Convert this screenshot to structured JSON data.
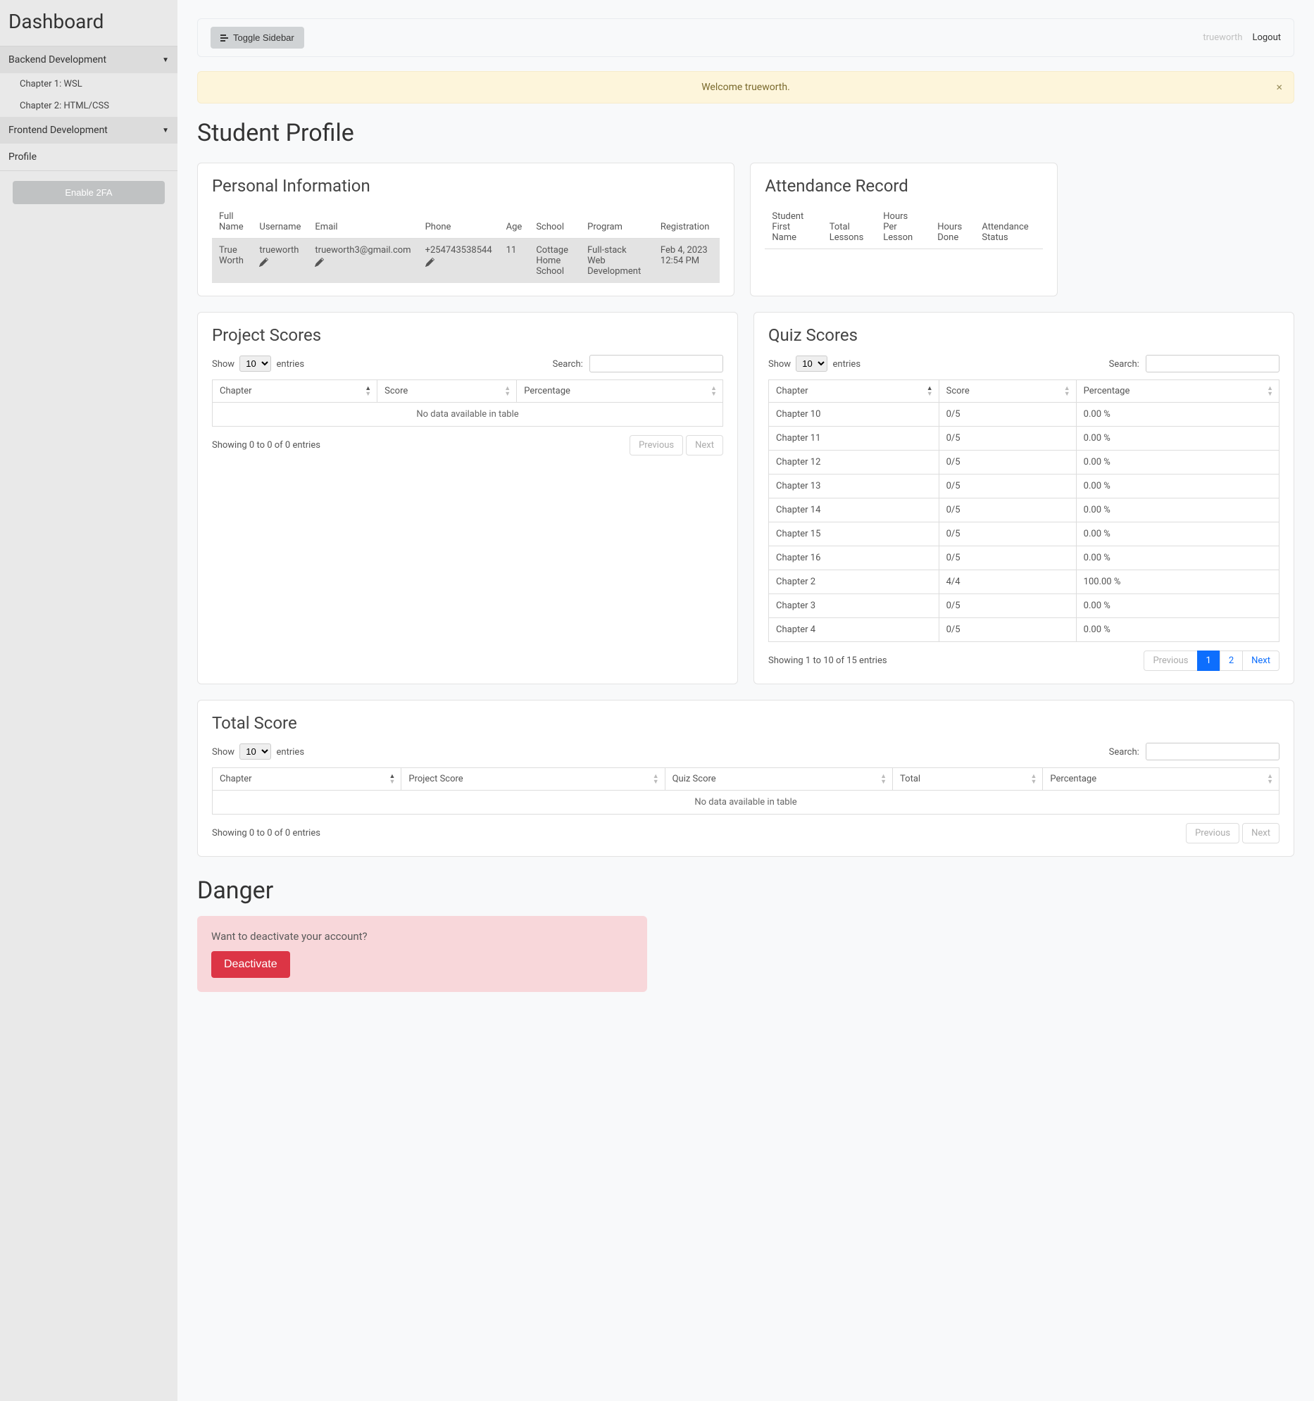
{
  "sidebar": {
    "title": "Dashboard",
    "categories": [
      {
        "label": "Backend Development",
        "subs": [
          "Chapter 1: WSL",
          "Chapter 2: HTML/CSS"
        ]
      },
      {
        "label": "Frontend Development",
        "subs": []
      }
    ],
    "profile_label": "Profile",
    "enable_2fa": "Enable 2FA"
  },
  "topbar": {
    "toggle": "Toggle Sidebar",
    "user": "trueworth",
    "logout": "Logout"
  },
  "alert": {
    "text": "Welcome trueworth.",
    "close": "×"
  },
  "page_title": "Student Profile",
  "personal": {
    "title": "Personal Information",
    "headers": {
      "full_name": "Full Name",
      "username": "Username",
      "email": "Email",
      "phone": "Phone",
      "age": "Age",
      "school": "School",
      "program": "Program",
      "registration": "Registration"
    },
    "row": {
      "full_name": "True Worth",
      "username": "trueworth",
      "email": "trueworth3@gmail.com",
      "phone": "+254743538544",
      "age": "11",
      "school": "Cottage Home School",
      "program": "Full-stack Web Development",
      "registration": "Feb 4, 2023 12:54 PM"
    }
  },
  "attendance": {
    "title": "Attendance Record",
    "headers": {
      "first_name": "Student First Name",
      "total_lessons": "Total Lessons",
      "hours_per_lesson": "Hours Per Lesson",
      "hours_done": "Hours Done",
      "status": "Attendance Status"
    }
  },
  "project": {
    "title": "Project Scores",
    "show": "Show",
    "entries": "entries",
    "search": "Search:",
    "headers": {
      "chapter": "Chapter",
      "score": "Score",
      "percentage": "Percentage"
    },
    "no_data": "No data available in table",
    "info": "Showing 0 to 0 of 0 entries",
    "prev": "Previous",
    "next": "Next",
    "page_size": "10"
  },
  "quiz": {
    "title": "Quiz Scores",
    "show": "Show",
    "entries": "entries",
    "search": "Search:",
    "headers": {
      "chapter": "Chapter",
      "score": "Score",
      "percentage": "Percentage"
    },
    "rows": [
      {
        "chapter": "Chapter 10",
        "score": "0/5",
        "percentage": "0.00 %"
      },
      {
        "chapter": "Chapter 11",
        "score": "0/5",
        "percentage": "0.00 %"
      },
      {
        "chapter": "Chapter 12",
        "score": "0/5",
        "percentage": "0.00 %"
      },
      {
        "chapter": "Chapter 13",
        "score": "0/5",
        "percentage": "0.00 %"
      },
      {
        "chapter": "Chapter 14",
        "score": "0/5",
        "percentage": "0.00 %"
      },
      {
        "chapter": "Chapter 15",
        "score": "0/5",
        "percentage": "0.00 %"
      },
      {
        "chapter": "Chapter 16",
        "score": "0/5",
        "percentage": "0.00 %"
      },
      {
        "chapter": "Chapter 2",
        "score": "4/4",
        "percentage": "100.00 %"
      },
      {
        "chapter": "Chapter 3",
        "score": "0/5",
        "percentage": "0.00 %"
      },
      {
        "chapter": "Chapter 4",
        "score": "0/5",
        "percentage": "0.00 %"
      }
    ],
    "info": "Showing 1 to 10 of 15 entries",
    "prev": "Previous",
    "next": "Next",
    "pages": [
      "1",
      "2"
    ],
    "page_size": "10"
  },
  "total": {
    "title": "Total Score",
    "show": "Show",
    "entries": "entries",
    "search": "Search:",
    "headers": {
      "chapter": "Chapter",
      "project_score": "Project Score",
      "quiz_score": "Quiz Score",
      "total": "Total",
      "percentage": "Percentage"
    },
    "no_data": "No data available in table",
    "info": "Showing 0 to 0 of 0 entries",
    "prev": "Previous",
    "next": "Next",
    "page_size": "10"
  },
  "danger": {
    "title": "Danger",
    "text": "Want to deactivate your account?",
    "button": "Deactivate"
  }
}
